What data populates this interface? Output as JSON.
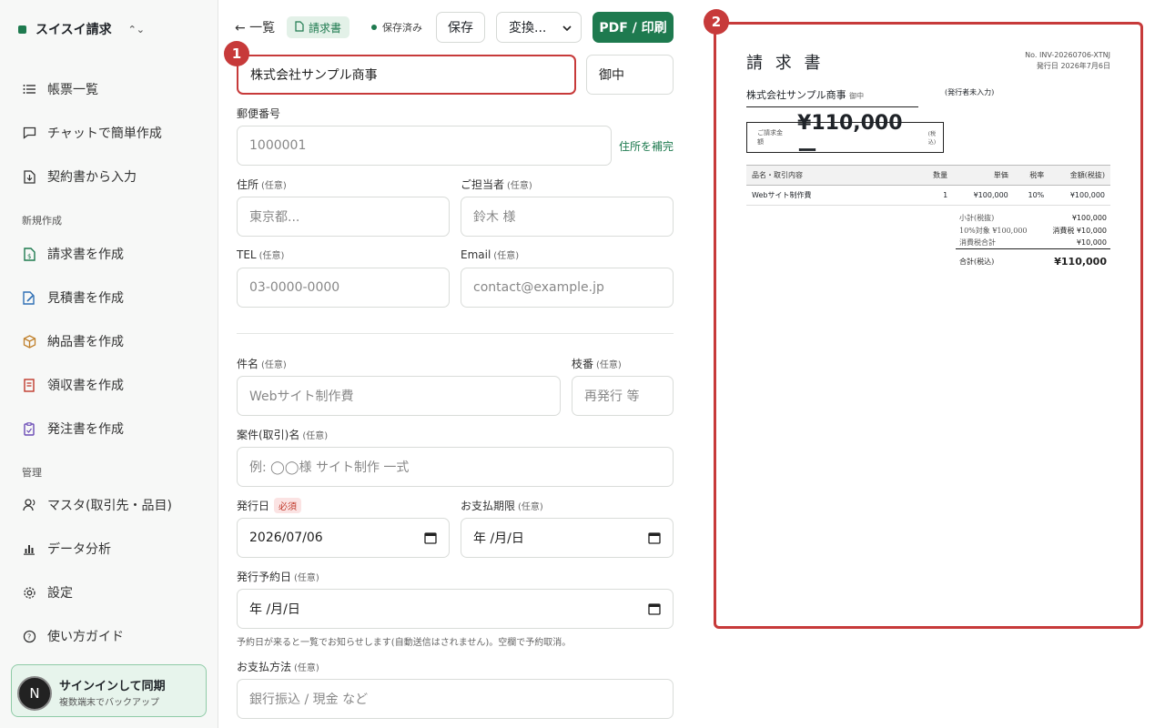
{
  "app": {
    "name": "スイスイ請求",
    "switcher_icon": "chevron-updown-icon"
  },
  "sidebar": {
    "items": [
      {
        "label": "帳票一覧",
        "icon": "list-icon"
      },
      {
        "label": "チャットで簡単作成",
        "icon": "chat-icon"
      },
      {
        "label": "契約書から入力",
        "icon": "file-import-icon"
      }
    ],
    "section_create": "新規作成",
    "create_items": [
      {
        "label": "請求書を作成",
        "icon": "invoice-icon",
        "color": "#1e7a4f"
      },
      {
        "label": "見積書を作成",
        "icon": "estimate-icon",
        "color": "#2f6fb5"
      },
      {
        "label": "納品書を作成",
        "icon": "package-icon",
        "color": "#c0802b"
      },
      {
        "label": "領収書を作成",
        "icon": "receipt-icon",
        "color": "#c0392b"
      },
      {
        "label": "発注書を作成",
        "icon": "order-icon",
        "color": "#6a4bb5"
      }
    ],
    "section_manage": "管理",
    "manage_items": [
      {
        "label": "マスタ(取引先・品目)",
        "icon": "user-icon"
      },
      {
        "label": "データ分析",
        "icon": "chart-icon"
      },
      {
        "label": "設定",
        "icon": "gear-icon"
      },
      {
        "label": "使い方ガイド",
        "icon": "help-icon"
      }
    ],
    "signin": {
      "avatar": "N",
      "title": "サインインして同期",
      "subtitle": "複数端末でバックアップ"
    }
  },
  "toolbar": {
    "back": "← 一覧",
    "doc_type": "請求書",
    "status": "保存済み",
    "save": "保存",
    "convert": "変換...",
    "pdf": "PDF / 印刷"
  },
  "form": {
    "client_name": "株式会社サンプル商事",
    "honorific": "御中",
    "postal": {
      "label": "郵便番号",
      "placeholder": "1000001",
      "link": "住所を補完"
    },
    "address": {
      "label": "住所",
      "optional": "(任意)",
      "placeholder": "東京都..."
    },
    "contact": {
      "label": "ご担当者",
      "optional": "(任意)",
      "placeholder": "鈴木 様"
    },
    "tel": {
      "label": "TEL",
      "optional": "(任意)",
      "placeholder": "03-0000-0000"
    },
    "email": {
      "label": "Email",
      "optional": "(任意)",
      "placeholder": "contact@example.jp"
    },
    "subject": {
      "label": "件名",
      "optional": "(任意)",
      "placeholder": "Webサイト制作費"
    },
    "branch": {
      "label": "枝番",
      "optional": "(任意)",
      "placeholder": "再発行 等"
    },
    "project": {
      "label": "案件(取引)名",
      "optional": "(任意)",
      "placeholder": "例: ◯◯様 サイト制作 一式"
    },
    "issue_date": {
      "label": "発行日",
      "required": "必須",
      "value": "2026/07/06"
    },
    "due_date": {
      "label": "お支払期限",
      "optional": "(任意)",
      "value": "年 /月/日"
    },
    "scheduled": {
      "label": "発行予約日",
      "optional": "(任意)",
      "value": "年 /月/日",
      "hint": "予約日が来ると一覧でお知らせします(自動送信はされません)。空欄で予約取消。"
    },
    "payment": {
      "label": "お支払方法",
      "optional": "(任意)",
      "placeholder": "銀行振込 / 現金 など"
    }
  },
  "markers": {
    "one": "1",
    "two": "2"
  },
  "preview": {
    "title": "請 求 書",
    "number": "No. INV-20260706-XTNJ",
    "issued": "発行日 2026年7月6日",
    "client": "株式会社サンプル商事",
    "honorific": "御中",
    "issuer": "(発行者未入力)",
    "amount_label": "ご請求金額",
    "amount": "¥110,000ー",
    "amount_tax": "(税込)",
    "headers": [
      "品名・取引内容",
      "数量",
      "単価",
      "税率",
      "金額(税抜)"
    ],
    "rows": [
      [
        "Webサイト制作費",
        "1",
        "¥100,000",
        "10%",
        "¥100,000"
      ]
    ],
    "totals": {
      "subtotal_label": "小計(税抜)",
      "subtotal": "¥100,000",
      "tax_target_label": "10%対象 ¥100,000",
      "tax_label": "消費税 ¥10,000",
      "tax_total_label": "消費税合計",
      "tax_total": "¥10,000",
      "grand_label": "合計(税込)",
      "grand": "¥110,000"
    }
  }
}
